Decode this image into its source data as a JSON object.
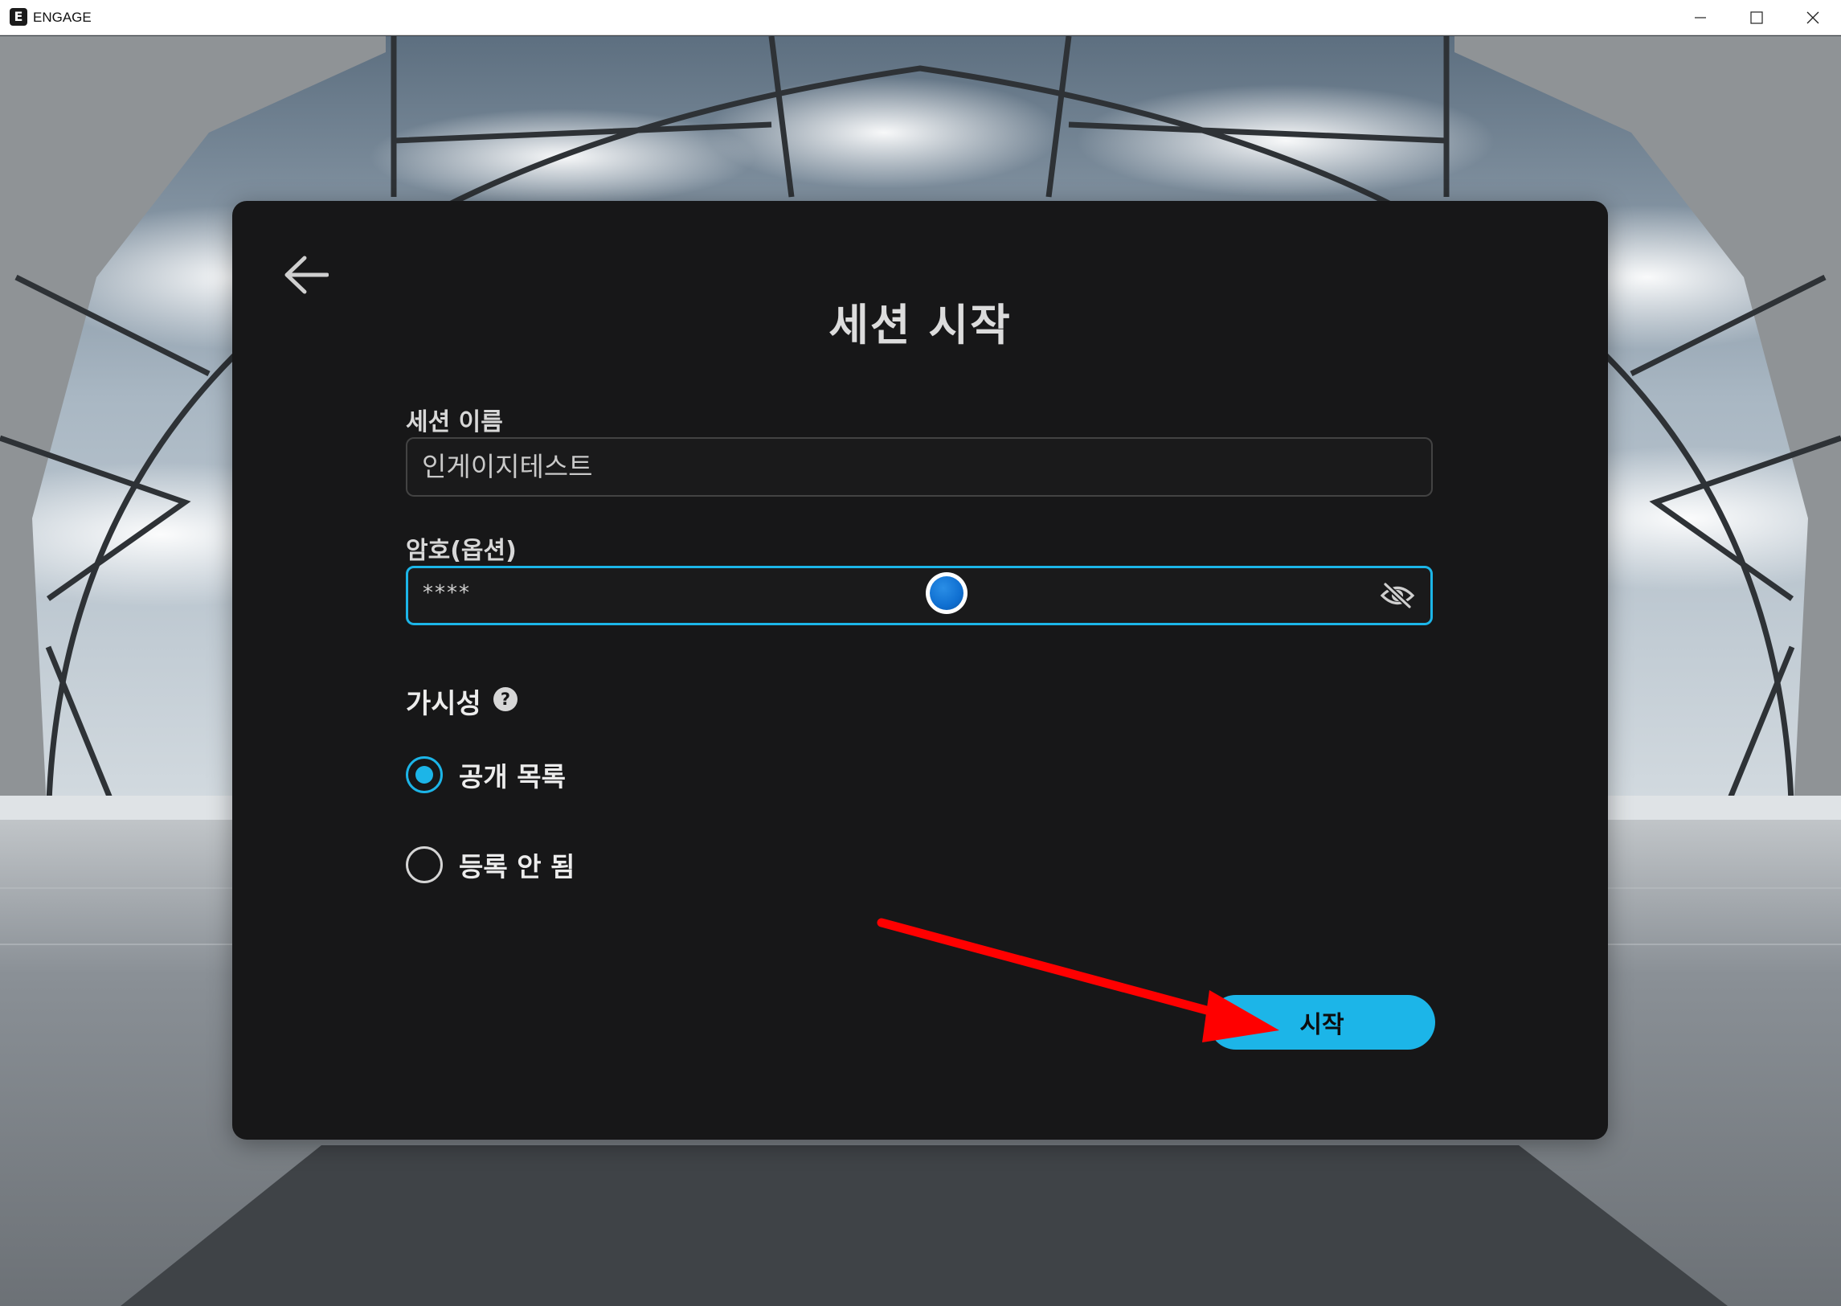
{
  "window": {
    "title": "ENGAGE",
    "logo_letter": "E"
  },
  "dialog": {
    "title": "세션 시작",
    "session_name": {
      "label": "세션 이름",
      "value": "인게이지테스트"
    },
    "password": {
      "label": "암호(옵션)",
      "value": "****"
    },
    "visibility": {
      "label": "가시성",
      "help_icon": "?",
      "options": [
        {
          "label": "공개 목록",
          "selected": true
        },
        {
          "label": "등록 안 됨",
          "selected": false
        }
      ]
    },
    "start_button": "시작"
  },
  "colors": {
    "accent": "#1cb5e8",
    "dialog_bg": "#171718",
    "annotation_arrow": "#ff0000"
  },
  "icons": {
    "back": "arrow-left-icon",
    "password_toggle": "eye-off-icon",
    "help": "help-circle-icon"
  }
}
